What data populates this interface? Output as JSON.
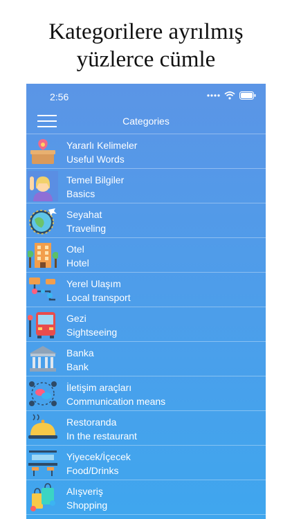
{
  "headline": {
    "line1": "Kategorilere ayrılmış",
    "line2": "yüzlerce cümle"
  },
  "status": {
    "time": "2:56"
  },
  "nav": {
    "title": "Categories"
  },
  "categories": [
    {
      "tr": "Yararlı Kelimeler",
      "en": "Useful Words",
      "icon": "gift-box-icon"
    },
    {
      "tr": "Temel Bilgiler",
      "en": "Basics",
      "icon": "waving-person-icon"
    },
    {
      "tr": "Seyahat",
      "en": "Traveling",
      "icon": "globe-plane-icon"
    },
    {
      "tr": "Otel",
      "en": "Hotel",
      "icon": "hotel-building-icon"
    },
    {
      "tr": "Yerel Ulaşım",
      "en": "Local transport",
      "icon": "transit-route-icon"
    },
    {
      "tr": "Gezi",
      "en": "Sightseeing",
      "icon": "bus-icon"
    },
    {
      "tr": "Banka",
      "en": "Bank",
      "icon": "bank-icon"
    },
    {
      "tr": "İletişim araçları",
      "en": "Communication means",
      "icon": "people-chat-icon"
    },
    {
      "tr": "Restoranda",
      "en": "In the restaurant",
      "icon": "cloche-icon"
    },
    {
      "tr": "Yiyecek/İçecek",
      "en": "Food/Drinks",
      "icon": "food-table-icon"
    },
    {
      "tr": "Alışveriş",
      "en": "Shopping",
      "icon": "shopping-bags-icon"
    }
  ]
}
